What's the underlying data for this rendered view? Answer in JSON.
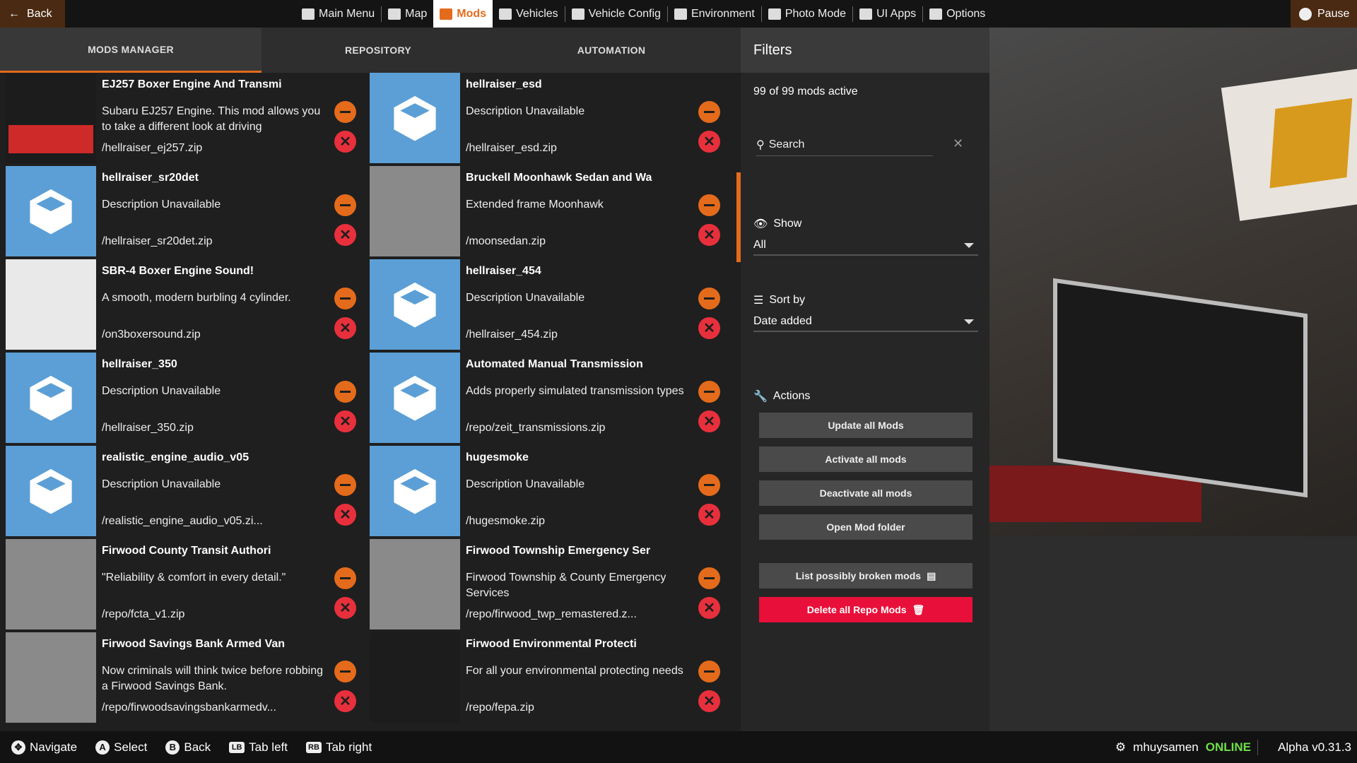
{
  "topbar": {
    "back_label": "Back",
    "pause_label": "Pause",
    "tabs": [
      {
        "label": "Main Menu",
        "icon": "main-menu-icon"
      },
      {
        "label": "Map",
        "icon": "map-icon"
      },
      {
        "label": "Mods",
        "icon": "puzzle-icon",
        "active": true
      },
      {
        "label": "Vehicles",
        "icon": "car-icon"
      },
      {
        "label": "Vehicle Config",
        "icon": "engine-icon"
      },
      {
        "label": "Environment",
        "icon": "weather-icon"
      },
      {
        "label": "Photo Mode",
        "icon": "camera-icon"
      },
      {
        "label": "UI Apps",
        "icon": "ui-apps-icon"
      },
      {
        "label": "Options",
        "icon": "sliders-icon"
      }
    ]
  },
  "subtabs": [
    "MODS MANAGER",
    "REPOSITORY",
    "AUTOMATION"
  ],
  "mods": [
    {
      "title": "EJ257 Boxer Engine And Transmi",
      "desc": "Subaru EJ257 Engine. This mod allows you to take a different look at driving",
      "path": "/hellraiser_ej257.zip",
      "thumb": "sti-logo"
    },
    {
      "title": "hellraiser_esd",
      "desc": "Description Unavailable",
      "path": "/hellraiser_esd.zip",
      "thumb": "cube"
    },
    {
      "title": "hellraiser_sr20det",
      "desc": "Description Unavailable",
      "path": "/hellraiser_sr20det.zip",
      "thumb": "cube"
    },
    {
      "title": "Bruckell Moonhawk Sedan and Wa",
      "desc": "Extended frame Moonhawk",
      "path": "/moonsedan.zip",
      "thumb": "photo"
    },
    {
      "title": "SBR-4 Boxer Engine Sound!",
      "desc": "A smooth, modern burbling 4 cylinder.",
      "path": "/on3boxersound.zip",
      "thumb": "light"
    },
    {
      "title": "hellraiser_454",
      "desc": "Description Unavailable",
      "path": "/hellraiser_454.zip",
      "thumb": "cube"
    },
    {
      "title": "hellraiser_350",
      "desc": "Description Unavailable",
      "path": "/hellraiser_350.zip",
      "thumb": "cube"
    },
    {
      "title": "Automated Manual Transmission",
      "desc": "Adds properly simulated transmission types",
      "path": "/repo/zeit_transmissions.zip",
      "thumb": "cube"
    },
    {
      "title": "realistic_engine_audio_v05",
      "desc": "Description Unavailable",
      "path": "/realistic_engine_audio_v05.zi...",
      "thumb": "cube"
    },
    {
      "title": "hugesmoke",
      "desc": "Description Unavailable",
      "path": "/hugesmoke.zip",
      "thumb": "cube"
    },
    {
      "title": "Firwood County Transit Authori",
      "desc": "\"Reliability & comfort in every detail.\"",
      "path": "/repo/fcta_v1.zip",
      "thumb": "photo"
    },
    {
      "title": "Firwood Township Emergency Ser",
      "desc": "Firwood Township & County Emergency Services",
      "path": "/repo/firwood_twp_remastered.z...",
      "thumb": "photo"
    },
    {
      "title": "Firwood Savings Bank Armed Van",
      "desc": "Now criminals will think twice before robbing a Firwood Savings Bank.",
      "path": "/repo/firwoodsavingsbankarmedv...",
      "thumb": "photo"
    },
    {
      "title": "Firwood Environmental Protecti",
      "desc": "For all your environmental protecting needs",
      "path": "/repo/fepa.zip",
      "thumb": "dark"
    }
  ],
  "filters": {
    "title": "Filters",
    "count": "99 of 99 mods active",
    "search_placeholder": "Search",
    "show_label": "Show",
    "show_value": "All",
    "sort_label": "Sort by",
    "sort_value": "Date added",
    "actions_label": "Actions",
    "actions": [
      "Update all Mods",
      "Activate all mods",
      "Deactivate all mods",
      "Open Mod folder"
    ],
    "broken_label": "List possibly broken mods",
    "delete_label": "Delete all Repo Mods"
  },
  "bottombar": {
    "hints": [
      {
        "key": "✥",
        "label": "Navigate"
      },
      {
        "key": "A",
        "label": "Select"
      },
      {
        "key": "B",
        "label": "Back"
      },
      {
        "key": "LB",
        "label": "Tab left"
      },
      {
        "key": "RB",
        "label": "Tab right"
      }
    ],
    "username": "mhuysamen",
    "status": "ONLINE",
    "version": "Alpha v0.31.3"
  },
  "colors": {
    "accent": "#e46b1b",
    "danger": "#e8303c",
    "online": "#6ee04a",
    "mod_thumb": "#5b9fd6"
  }
}
